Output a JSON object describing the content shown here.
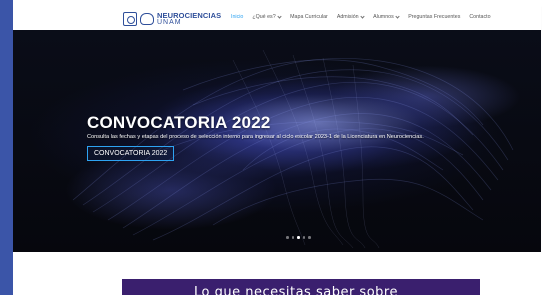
{
  "brand": {
    "name_line1": "NEUROCIENCIAS",
    "name_line2": "UNAM",
    "accent_color": "#2ea3f2",
    "logo_color": "#2f4f9a"
  },
  "nav": {
    "items": [
      {
        "label": "Inicio",
        "active": true,
        "dropdown": false
      },
      {
        "label": "¿Qué es?",
        "active": false,
        "dropdown": true
      },
      {
        "label": "Mapa Curricular",
        "active": false,
        "dropdown": false
      },
      {
        "label": "Admisión",
        "active": false,
        "dropdown": true
      },
      {
        "label": "Alumnos",
        "active": false,
        "dropdown": true
      },
      {
        "label": "Preguntas Frecuentes",
        "active": false,
        "dropdown": false
      },
      {
        "label": "Contacto",
        "active": false,
        "dropdown": false
      }
    ]
  },
  "hero": {
    "title": "CONVOCATORIA 2022",
    "subtitle": "Consulta las fechas y etapas del proceso de selección interno para ingresar al ciclo escolar 2023-1 de la Licenciatura en Neurociencias.",
    "button_label": "CONVOCATORIA 2022",
    "slide_count": 5,
    "active_slide": 3
  },
  "section": {
    "card_text": "Lo que necesitas saber sobre"
  }
}
